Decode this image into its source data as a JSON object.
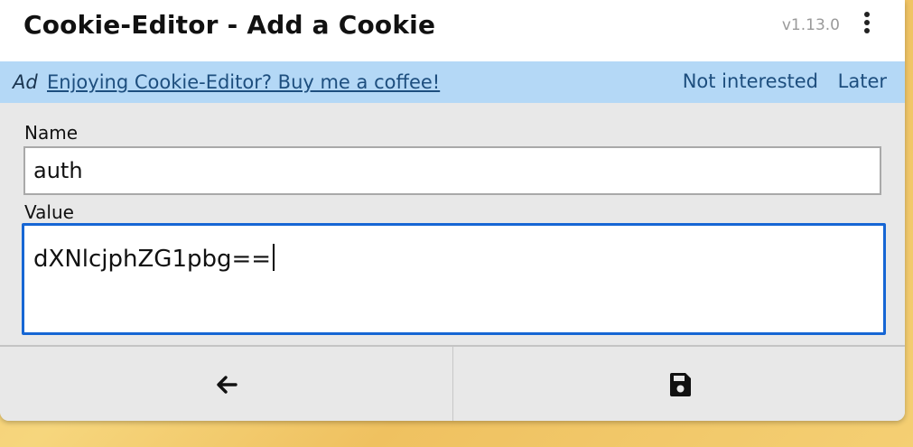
{
  "header": {
    "title": "Cookie-Editor - Add a Cookie",
    "version": "v1.13.0",
    "menu_icon": "more-vertical-icon"
  },
  "ad": {
    "tag": "Ad",
    "link_text": "Enjoying Cookie-Editor? Buy me a coffee!",
    "not_interested": "Not interested",
    "later": "Later",
    "background": "#b4d8f6"
  },
  "form": {
    "name_label": "Name",
    "name_value": "auth",
    "value_label": "Value",
    "value_value": "dXNlcjphZG1pbg=="
  },
  "toolbar": {
    "back_icon": "arrow-left-icon",
    "save_icon": "floppy-disk-icon"
  },
  "colors": {
    "focus_border": "#1666d4",
    "panel_background": "#e8e8e8"
  }
}
